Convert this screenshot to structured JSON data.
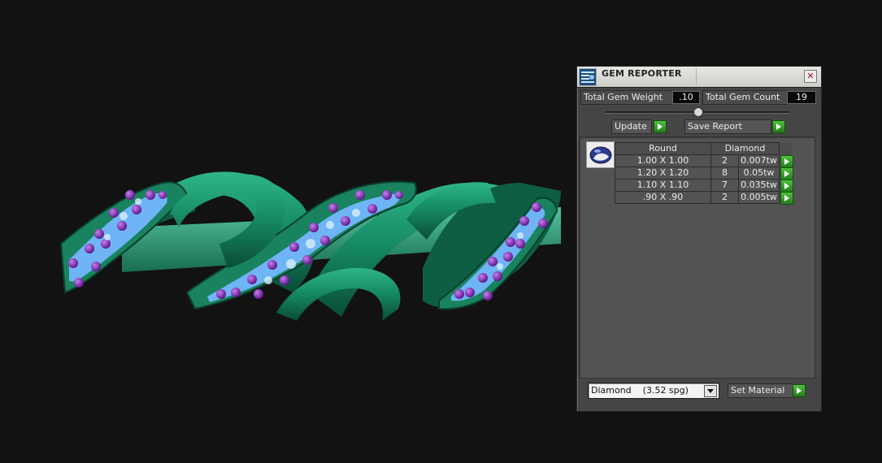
{
  "window": {
    "title": "GEM REPORTER"
  },
  "summary": {
    "total_weight_label": "Total Gem Weight",
    "total_weight_value": ".10",
    "total_count_label": "Total Gem Count",
    "total_count_value": "19"
  },
  "actions": {
    "update_label": "Update",
    "save_report_label": "Save Report"
  },
  "report": {
    "headers": {
      "shape": "Round",
      "material": "Diamond"
    },
    "rows": [
      {
        "size": "1.00 X 1.00",
        "count": "2",
        "weight": "0.007tw"
      },
      {
        "size": "1.20 X 1.20",
        "count": "8",
        "weight": "0.05tw"
      },
      {
        "size": "1.10 X 1.10",
        "count": "7",
        "weight": "0.035tw"
      },
      {
        "size": ".90 X .90",
        "count": "2",
        "weight": "0.005tw"
      }
    ]
  },
  "material": {
    "selected": "Diamond    (3.52 spg)",
    "set_label": "Set Material"
  },
  "icons": {
    "app": "gem-reporter-icon",
    "close": "close-icon",
    "go": "green-play-arrow-icon",
    "gem_shape": "round-gem-icon"
  },
  "colors": {
    "viewport_bg": "#121212",
    "metal": "#1f8a63",
    "gem_purple": "#8a2bb8",
    "pave_blue": "#6fb4f5",
    "go_green": "#3aa82c"
  }
}
